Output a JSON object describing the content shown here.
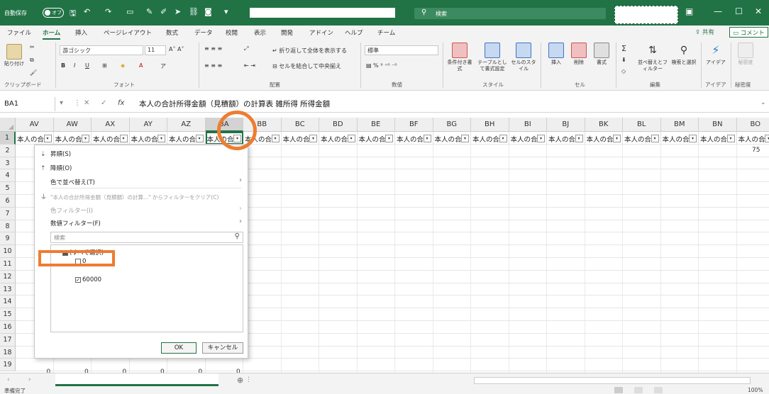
{
  "titlebar": {
    "autosave_label": "自動保存",
    "autosave_state": "オフ",
    "search_label": "検索",
    "colors": {
      "bg": "#217346",
      "accent": "#ed7d31"
    }
  },
  "menu": {
    "tabs": [
      "ファイル",
      "ホーム",
      "挿入",
      "ページレイアウト",
      "数式",
      "データ",
      "校閲",
      "表示",
      "開発",
      "アドイン",
      "ヘルプ",
      "チーム"
    ],
    "active_tab": "ホーム",
    "share": "共有",
    "comment": "コメント"
  },
  "ribbon": {
    "paste": "貼り付け",
    "clipboard_group": "クリップボード",
    "font_name": "游ゴシック",
    "font_size": "11",
    "font_group": "フォント",
    "wrap_text": "折り返して全体を表示する",
    "merge_center": "セルを結合して中央揃え",
    "alignment_group": "配置",
    "number_format": "標準",
    "number_group": "数値",
    "conditional_format": "条件付き書式",
    "format_as_table": "テーブルとして書式設定",
    "cell_styles": "セルのスタイル",
    "styles_group": "スタイル",
    "insert": "挿入",
    "delete": "削除",
    "format": "書式",
    "cells_group": "セル",
    "sort_filter": "並べ替えとフィルター",
    "find_select": "検索と選択",
    "editing_group": "編集",
    "ideas": "アイデア",
    "ideas_group": "アイデア",
    "sensitivity": "秘密度",
    "sensitivity_group": "秘密度"
  },
  "formula_bar": {
    "name_box": "BA1",
    "fx": "fx",
    "formula": "本人の合計所得金額（見積額）の計算表 雑所得 所得金額"
  },
  "grid": {
    "columns": [
      "AV",
      "AW",
      "AX",
      "AY",
      "AZ",
      "BA",
      "BB",
      "BC",
      "BD",
      "BE",
      "BF",
      "BG",
      "BH",
      "BI",
      "BJ",
      "BK",
      "BL",
      "BM",
      "BN",
      "BO"
    ],
    "selected_column": "BA",
    "rows": [
      "1",
      "2",
      "3",
      "4",
      "5",
      "6",
      "7",
      "8",
      "9",
      "10",
      "11",
      "12",
      "13",
      "14",
      "15",
      "16",
      "17",
      "18",
      "19"
    ],
    "row1_text": "本人の合",
    "row2_right_value": "75",
    "row19_values": [
      "0",
      "0",
      "0",
      "0",
      "0",
      "0"
    ]
  },
  "filter_menu": {
    "sort_asc": "昇順(S)",
    "sort_desc": "降順(O)",
    "sort_by_color": "色で並べ替え(T)",
    "clear_filter": "\"本人の合計所得金額（見積額）の計算...\" からフィルターをクリア(C)",
    "color_filter": "色フィルター(I)",
    "number_filter": "数値フィルター(F)",
    "search_placeholder": "検索",
    "options": [
      {
        "label": "(すべて選択)",
        "checked": "partial"
      },
      {
        "label": "0",
        "checked": false
      },
      {
        "label": "60000",
        "checked": true
      }
    ],
    "ok": "OK",
    "cancel": "キャンセル"
  },
  "status": {
    "ready": "準備完了",
    "zoom": "100%"
  }
}
